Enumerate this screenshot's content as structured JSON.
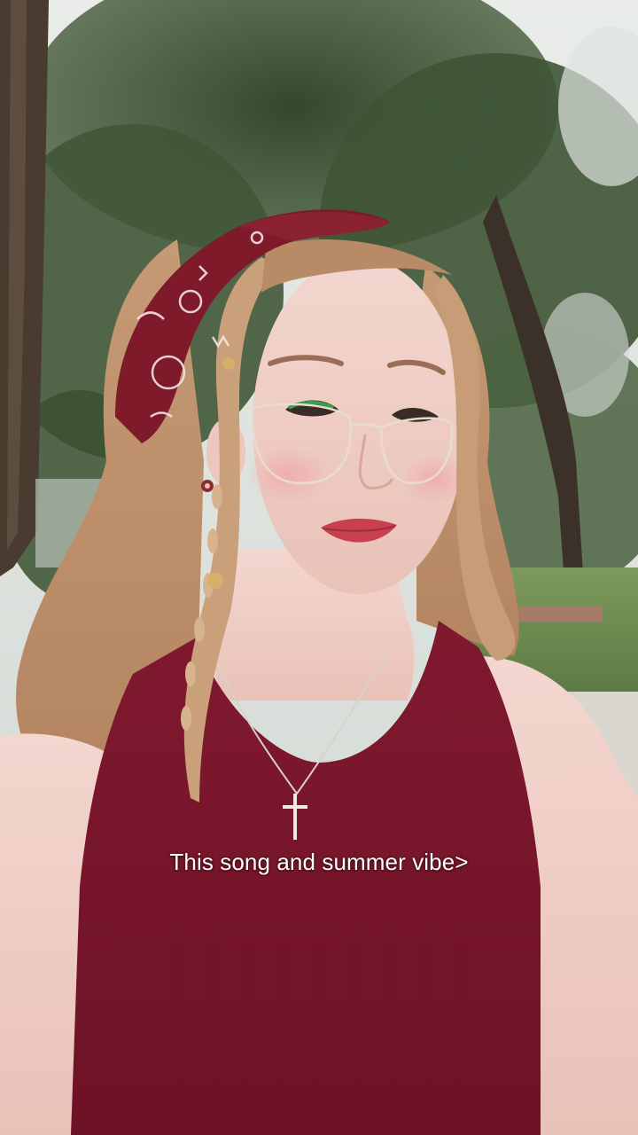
{
  "video": {
    "caption": "This song and summer vibe>",
    "scene_description_icon": "portrait-video-frame",
    "colors": {
      "shirt": "#7a1730",
      "bandana": "#7e1a2a",
      "foliage": "#3f5434",
      "sky": "#e6eae6",
      "caption_text": "#ffffff"
    }
  }
}
